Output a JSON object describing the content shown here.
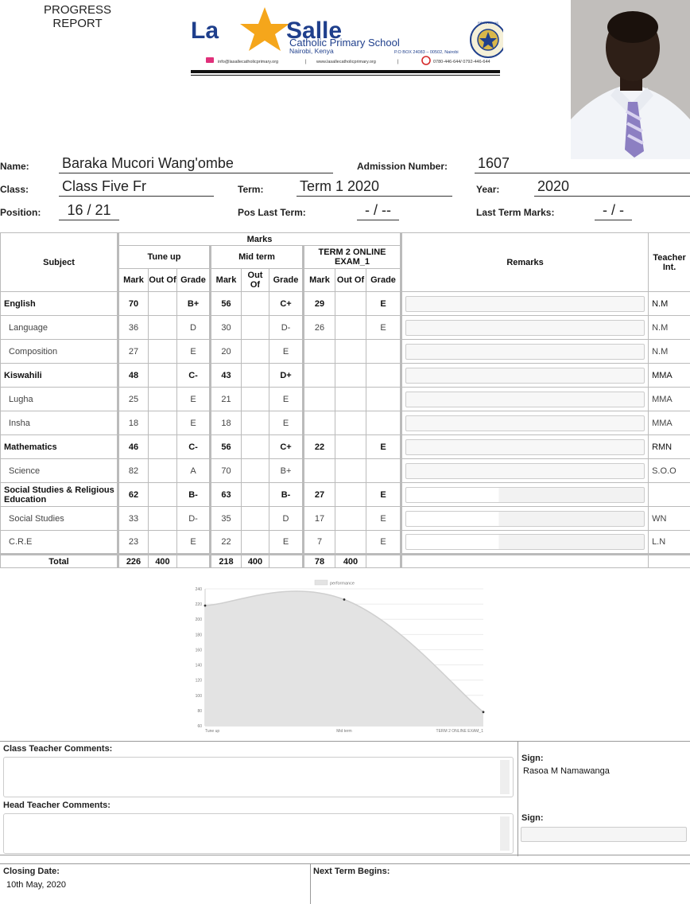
{
  "header": {
    "report_title_line1": "PROGRESS",
    "report_title_line2": "REPORT",
    "logo": {
      "name_part1": "La",
      "name_part2": "Salle",
      "school_name": "Catholic Primary School",
      "location": "Nairobi, Kenya",
      "po_box": "P.O BOX 24083 – 00502, Nairobi",
      "email": "info@lasallecatholicprimary.org",
      "website": "www.lasallecatholicprimary.org",
      "phone": "0780-446-644/ 0792-446-644",
      "crest_text": "FIDES ZELUS"
    }
  },
  "student": {
    "name_label": "Name:",
    "name": "Baraka Mucori Wang'ombe",
    "admission_label": "Admission Number:",
    "admission_number": "1607",
    "class_label": "Class:",
    "class": "Class Five Fr",
    "term_label": "Term:",
    "term": "Term 1 2020",
    "year_label": "Year:",
    "year": "2020",
    "position_label": "Position:",
    "position": "16 / 21",
    "pos_last_term_label": "Pos Last Term:",
    "pos_last_term": "- / --",
    "last_term_marks_label": "Last Term Marks:",
    "last_term_marks": "- / -"
  },
  "table": {
    "subject_header": "Subject",
    "marks_header": "Marks",
    "remarks_header": "Remarks",
    "teacher_header": "Teacher Int.",
    "exams": [
      "Tune up",
      "Mid term",
      "TERM 2 ONLINE EXAM_1"
    ],
    "col_mark": "Mark",
    "col_outof": "Out Of",
    "col_grade": "Grade",
    "rows": [
      {
        "subject": "English",
        "kind": "main",
        "m1": "70",
        "g1": "B+",
        "m2": "56",
        "g2": "C+",
        "m3": "29",
        "g3": "E",
        "teacher": "N.M",
        "remark_fill": 1
      },
      {
        "subject": "Language",
        "kind": "sub",
        "m1": "36",
        "g1": "D",
        "m2": "30",
        "g2": "D-",
        "m3": "26",
        "g3": "E",
        "teacher": "N.M",
        "remark_fill": 1
      },
      {
        "subject": "Composition",
        "kind": "sub",
        "m1": "27",
        "g1": "E",
        "m2": "20",
        "g2": "E",
        "m3": "",
        "g3": "",
        "teacher": "N.M",
        "remark_fill": 1
      },
      {
        "subject": "Kiswahili",
        "kind": "main",
        "m1": "48",
        "g1": "C-",
        "m2": "43",
        "g2": "D+",
        "m3": "",
        "g3": "",
        "teacher": "MMA",
        "remark_fill": 1
      },
      {
        "subject": "Lugha",
        "kind": "sub",
        "m1": "25",
        "g1": "E",
        "m2": "21",
        "g2": "E",
        "m3": "",
        "g3": "",
        "teacher": "MMA",
        "remark_fill": 1
      },
      {
        "subject": "Insha",
        "kind": "sub",
        "m1": "18",
        "g1": "E",
        "m2": "18",
        "g2": "E",
        "m3": "",
        "g3": "",
        "teacher": "MMA",
        "remark_fill": 1
      },
      {
        "subject": "Mathematics",
        "kind": "main",
        "m1": "46",
        "g1": "C-",
        "m2": "56",
        "g2": "C+",
        "m3": "22",
        "g3": "E",
        "teacher": "RMN",
        "remark_fill": 1
      },
      {
        "subject": "Science",
        "kind": "sub",
        "m1": "82",
        "g1": "A",
        "m2": "70",
        "g2": "B+",
        "m3": "",
        "g3": "",
        "teacher": "S.O.O",
        "remark_fill": 1
      },
      {
        "subject": "Social Studies & Religious Education",
        "kind": "main",
        "m1": "62",
        "g1": "B-",
        "m2": "63",
        "g2": "B-",
        "m3": "27",
        "g3": "E",
        "teacher": "",
        "remark_fill": 0.39
      },
      {
        "subject": "Social Studies",
        "kind": "sub",
        "m1": "33",
        "g1": "D-",
        "m2": "35",
        "g2": "D",
        "m3": "17",
        "g3": "E",
        "teacher": "WN",
        "remark_fill": 0.39
      },
      {
        "subject": "C.R.E",
        "kind": "sub",
        "m1": "23",
        "g1": "E",
        "m2": "22",
        "g2": "E",
        "m3": "7",
        "g3": "E",
        "teacher": "L.N",
        "remark_fill": 0.39
      }
    ],
    "total": {
      "label": "Total",
      "m1": "226",
      "o1": "400",
      "m2": "218",
      "o2": "400",
      "m3": "78",
      "o3": "400"
    }
  },
  "chart_data": {
    "type": "area",
    "categories": [
      "Tune up",
      "Mid term",
      "TERM 2 ONLINE EXAM_1"
    ],
    "series": [
      {
        "name": "performance",
        "values": [
          218,
          226,
          78
        ]
      }
    ],
    "ylim": [
      60,
      240
    ],
    "yticks": [
      60,
      80,
      100,
      120,
      140,
      160,
      180,
      200,
      220,
      240
    ],
    "legend": "top",
    "grid": true,
    "fill_color": "#e3e3e3",
    "line_color": "#cfcfcf"
  },
  "comments": {
    "class_teacher_label": "Class Teacher Comments:",
    "class_teacher_comment": "",
    "head_teacher_label": "Head Teacher Comments:",
    "head_teacher_comment": "",
    "sign_label_1": "Sign:",
    "class_teacher_sign": "Rasoa M Namawanga",
    "sign_label_2": "Sign:"
  },
  "footer": {
    "closing_label": "Closing Date:",
    "closing_date": "10th May, 2020",
    "next_term_label": "Next Term Begins:",
    "next_term_date": ""
  }
}
